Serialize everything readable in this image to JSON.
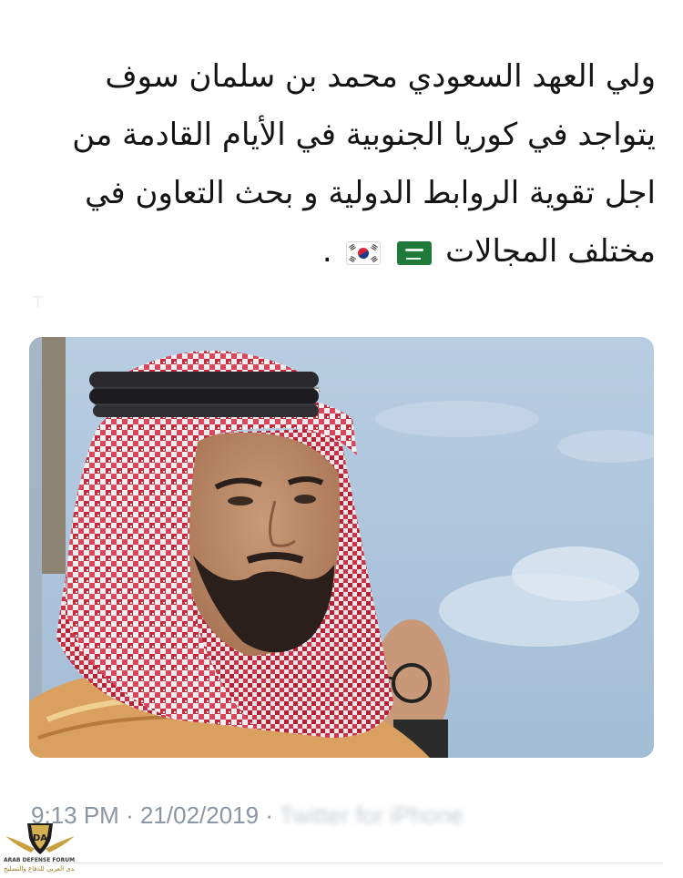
{
  "tweet": {
    "lines": [
      "ولي العهد السعودي محمد بن سلمان سوف",
      "يتواجد في كوريا الجنوبية في الأيام القادمة من",
      "اجل تقوية الروابط الدولية و بحث التعاون في",
      "مختلف المجالات"
    ],
    "end_punctuation": "."
  },
  "flags": [
    "saudi-arabia-flag-emoji",
    "south-korea-flag-emoji"
  ],
  "photo": {
    "subject": "man in red-and-white checkered ghutra with black agal"
  },
  "meta": {
    "time": "9:13 PM",
    "separator": "·",
    "date": "21/02/2019",
    "separator2": "·",
    "client": "Twitter for iPhone"
  },
  "watermark": {
    "letters": "DA",
    "name_en": "ARAB DEFENSE FORUM",
    "name_ar": "المنتدى العربي للدفاع والتسليح"
  },
  "colors": {
    "text": "#141414",
    "meta": "#8a96a3",
    "sky": "#a9c3dc",
    "keffiyeh_red": "#c8283c",
    "bisht_gold": "#d9a060"
  }
}
